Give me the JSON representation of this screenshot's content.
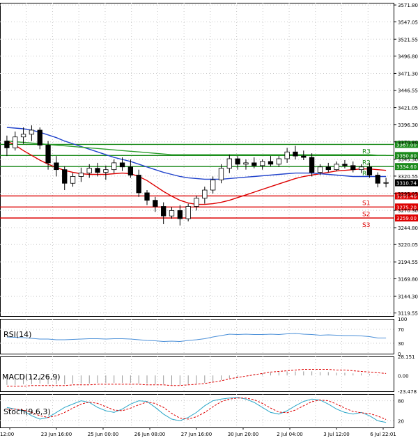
{
  "chart_data": {
    "type": "candlestick",
    "price_axis": {
      "ticks": [
        "3571.80",
        "3547.05",
        "3521.55",
        "3496.80",
        "3471.30",
        "3446.55",
        "3421.05",
        "3396.30",
        "3370.80",
        "3345.30",
        "3320.55",
        "3295.05",
        "3270.30",
        "3244.80",
        "3220.05",
        "3194.55",
        "3169.80",
        "3144.30",
        "3119.55"
      ],
      "range": [
        3115,
        3575
      ],
      "current_price": "3310.74"
    },
    "x_axis": {
      "labels": [
        "12:00",
        "23 Jun 16:00",
        "25 Jun 00:00",
        "26 Jun 08:00",
        "27 Jun 16:00",
        "30 Jun 20:00",
        "2 Jul 04:00",
        "3 Jul 12:00",
        "6 Jul 22:01"
      ]
    },
    "levels": [
      {
        "name": "R3",
        "value": 3367.0,
        "label": "3367.00",
        "color": "#1a8a1a"
      },
      {
        "name": "R2",
        "value": 3350.8,
        "label": "3350.80",
        "color": "#1a8a1a"
      },
      {
        "name": "R1",
        "value": 3334.6,
        "label": "3334.60",
        "color": "#1a8a1a"
      },
      {
        "name": "S1",
        "value": 3291.4,
        "label": "3291.40",
        "color": "#dd0000"
      },
      {
        "name": "S2",
        "value": 3275.2,
        "label": "3275.20",
        "color": "#dd0000"
      },
      {
        "name": "S3",
        "value": 3259.0,
        "label": "3259.00",
        "color": "#dd0000"
      }
    ],
    "candles": [
      {
        "o": 3372,
        "h": 3380,
        "l": 3350,
        "c": 3362
      },
      {
        "o": 3362,
        "h": 3386,
        "l": 3358,
        "c": 3378
      },
      {
        "o": 3378,
        "h": 3392,
        "l": 3368,
        "c": 3382
      },
      {
        "o": 3382,
        "h": 3395,
        "l": 3372,
        "c": 3388
      },
      {
        "o": 3388,
        "h": 3392,
        "l": 3360,
        "c": 3366
      },
      {
        "o": 3366,
        "h": 3372,
        "l": 3330,
        "c": 3340
      },
      {
        "o": 3340,
        "h": 3350,
        "l": 3320,
        "c": 3330
      },
      {
        "o": 3330,
        "h": 3335,
        "l": 3300,
        "c": 3310
      },
      {
        "o": 3310,
        "h": 3325,
        "l": 3305,
        "c": 3320
      },
      {
        "o": 3320,
        "h": 3333,
        "l": 3312,
        "c": 3325
      },
      {
        "o": 3325,
        "h": 3338,
        "l": 3318,
        "c": 3332
      },
      {
        "o": 3332,
        "h": 3340,
        "l": 3320,
        "c": 3326
      },
      {
        "o": 3326,
        "h": 3336,
        "l": 3315,
        "c": 3330
      },
      {
        "o": 3330,
        "h": 3345,
        "l": 3325,
        "c": 3340
      },
      {
        "o": 3340,
        "h": 3348,
        "l": 3328,
        "c": 3334
      },
      {
        "o": 3334,
        "h": 3345,
        "l": 3318,
        "c": 3322
      },
      {
        "o": 3322,
        "h": 3330,
        "l": 3290,
        "c": 3296
      },
      {
        "o": 3296,
        "h": 3300,
        "l": 3278,
        "c": 3285
      },
      {
        "o": 3285,
        "h": 3290,
        "l": 3268,
        "c": 3276
      },
      {
        "o": 3276,
        "h": 3282,
        "l": 3250,
        "c": 3262
      },
      {
        "o": 3262,
        "h": 3275,
        "l": 3258,
        "c": 3270
      },
      {
        "o": 3270,
        "h": 3278,
        "l": 3248,
        "c": 3258
      },
      {
        "o": 3258,
        "h": 3280,
        "l": 3254,
        "c": 3276
      },
      {
        "o": 3276,
        "h": 3292,
        "l": 3270,
        "c": 3288
      },
      {
        "o": 3288,
        "h": 3305,
        "l": 3280,
        "c": 3300
      },
      {
        "o": 3300,
        "h": 3320,
        "l": 3295,
        "c": 3315
      },
      {
        "o": 3315,
        "h": 3338,
        "l": 3310,
        "c": 3332
      },
      {
        "o": 3332,
        "h": 3352,
        "l": 3325,
        "c": 3346
      },
      {
        "o": 3346,
        "h": 3350,
        "l": 3330,
        "c": 3338
      },
      {
        "o": 3338,
        "h": 3345,
        "l": 3330,
        "c": 3340
      },
      {
        "o": 3340,
        "h": 3348,
        "l": 3332,
        "c": 3336
      },
      {
        "o": 3336,
        "h": 3345,
        "l": 3330,
        "c": 3342
      },
      {
        "o": 3342,
        "h": 3350,
        "l": 3335,
        "c": 3338
      },
      {
        "o": 3338,
        "h": 3350,
        "l": 3334,
        "c": 3346
      },
      {
        "o": 3346,
        "h": 3362,
        "l": 3340,
        "c": 3356
      },
      {
        "o": 3356,
        "h": 3365,
        "l": 3345,
        "c": 3350
      },
      {
        "o": 3350,
        "h": 3358,
        "l": 3344,
        "c": 3348
      },
      {
        "o": 3348,
        "h": 3354,
        "l": 3320,
        "c": 3326
      },
      {
        "o": 3326,
        "h": 3338,
        "l": 3322,
        "c": 3334
      },
      {
        "o": 3334,
        "h": 3340,
        "l": 3326,
        "c": 3330
      },
      {
        "o": 3330,
        "h": 3342,
        "l": 3328,
        "c": 3338
      },
      {
        "o": 3338,
        "h": 3344,
        "l": 3332,
        "c": 3336
      },
      {
        "o": 3336,
        "h": 3342,
        "l": 3326,
        "c": 3330
      },
      {
        "o": 3330,
        "h": 3338,
        "l": 3325,
        "c": 3334
      },
      {
        "o": 3334,
        "h": 3340,
        "l": 3318,
        "c": 3322
      },
      {
        "o": 3322,
        "h": 3326,
        "l": 3304,
        "c": 3310
      },
      {
        "o": 3310,
        "h": 3318,
        "l": 3304,
        "c": 3311
      }
    ],
    "moving_averages": [
      {
        "color": "#dd0000",
        "values": [
          3372,
          3366,
          3358,
          3351,
          3344,
          3338,
          3333,
          3329,
          3326,
          3324,
          3323,
          3323,
          3323,
          3324,
          3325,
          3324,
          3320,
          3314,
          3306,
          3298,
          3291,
          3285,
          3281,
          3279,
          3279,
          3280,
          3282,
          3285,
          3289,
          3293,
          3297,
          3301,
          3305,
          3309,
          3313,
          3317,
          3320,
          3322,
          3324,
          3326,
          3328,
          3329,
          3330,
          3331,
          3331,
          3330,
          3329
        ]
      },
      {
        "color": "#2244cc",
        "values": [
          3392,
          3391,
          3390,
          3388,
          3385,
          3381,
          3377,
          3372,
          3368,
          3364,
          3360,
          3356,
          3352,
          3348,
          3345,
          3342,
          3338,
          3334,
          3330,
          3326,
          3323,
          3320,
          3318,
          3317,
          3316,
          3316,
          3316,
          3317,
          3318,
          3319,
          3320,
          3321,
          3322,
          3323,
          3324,
          3325,
          3325,
          3325,
          3324,
          3323,
          3322,
          3321,
          3320,
          3320,
          3320,
          3320,
          3320
        ]
      },
      {
        "color": "#2e9e2e",
        "values": [
          3372,
          3371,
          3370,
          3369,
          3368,
          3367,
          3366,
          3365,
          3364,
          3363,
          3362,
          3361,
          3360,
          3359,
          3358,
          3357,
          3356,
          3355,
          3354,
          3353,
          3352,
          3352,
          3352,
          3352,
          3352,
          3352,
          3352,
          3352,
          3352,
          3352,
          3352,
          3352,
          3352,
          3352,
          3352,
          3352,
          3352,
          3352,
          3352,
          3352,
          3352,
          3352,
          3352,
          3352,
          3352,
          3351,
          3351
        ]
      }
    ],
    "rsi": {
      "label": "RSI(14)",
      "ticks": [
        "100",
        "70",
        "30",
        "0"
      ],
      "color": "#4a8fd8",
      "values": [
        48,
        47,
        46,
        44,
        42,
        42,
        40,
        40,
        41,
        42,
        43,
        43,
        42,
        43,
        43,
        42,
        40,
        38,
        37,
        35,
        36,
        35,
        38,
        40,
        43,
        48,
        52,
        56,
        55,
        56,
        55,
        55,
        56,
        55,
        57,
        58,
        56,
        55,
        53,
        54,
        53,
        52,
        52,
        51,
        49,
        45,
        45
      ]
    },
    "macd": {
      "label": "MACD(12,26,9)",
      "ticks": [
        "28.151",
        "0.00",
        "-23.478"
      ],
      "range": [
        -23.478,
        28.151
      ],
      "histogram": [
        -14,
        -14,
        -13,
        -13,
        -12,
        -13,
        -13,
        -13,
        -12,
        -12,
        -12,
        -11,
        -11,
        -11,
        -11,
        -11,
        -12,
        -12,
        -13,
        -13,
        -14,
        -14,
        -13,
        -12,
        -11,
        -9,
        -7,
        -4,
        -2,
        0,
        2,
        3,
        4,
        5,
        6,
        6,
        6,
        6,
        5,
        5,
        4,
        4,
        3,
        3,
        2,
        1,
        0
      ],
      "signal": [
        -16,
        -16,
        -16,
        -15,
        -15,
        -15,
        -15,
        -15,
        -14,
        -14,
        -14,
        -13,
        -13,
        -13,
        -13,
        -13,
        -13,
        -14,
        -14,
        -14,
        -15,
        -15,
        -14,
        -13,
        -12,
        -10,
        -8,
        -5,
        -3,
        -1,
        1,
        3,
        5,
        6,
        7,
        8,
        9,
        9,
        9,
        9,
        8,
        8,
        7,
        6,
        5,
        4,
        3
      ]
    },
    "stoch": {
      "label": "Stoch(9,6,3)",
      "ticks": [
        "80",
        "20"
      ],
      "main_color": "#2aa6c8",
      "signal_color": "#dd0000",
      "k": [
        60,
        55,
        50,
        35,
        25,
        30,
        45,
        60,
        70,
        80,
        75,
        60,
        50,
        45,
        55,
        70,
        80,
        78,
        60,
        40,
        25,
        20,
        30,
        45,
        65,
        80,
        85,
        88,
        90,
        85,
        75,
        60,
        45,
        40,
        50,
        65,
        78,
        85,
        82,
        70,
        55,
        45,
        40,
        45,
        35,
        20,
        15
      ],
      "d": [
        55,
        55,
        52,
        45,
        35,
        30,
        35,
        45,
        58,
        70,
        76,
        72,
        62,
        52,
        50,
        58,
        68,
        76,
        72,
        60,
        42,
        28,
        25,
        32,
        45,
        62,
        77,
        85,
        88,
        88,
        83,
        72,
        58,
        46,
        44,
        52,
        65,
        77,
        82,
        80,
        70,
        58,
        48,
        44,
        42,
        34,
        24
      ]
    }
  }
}
